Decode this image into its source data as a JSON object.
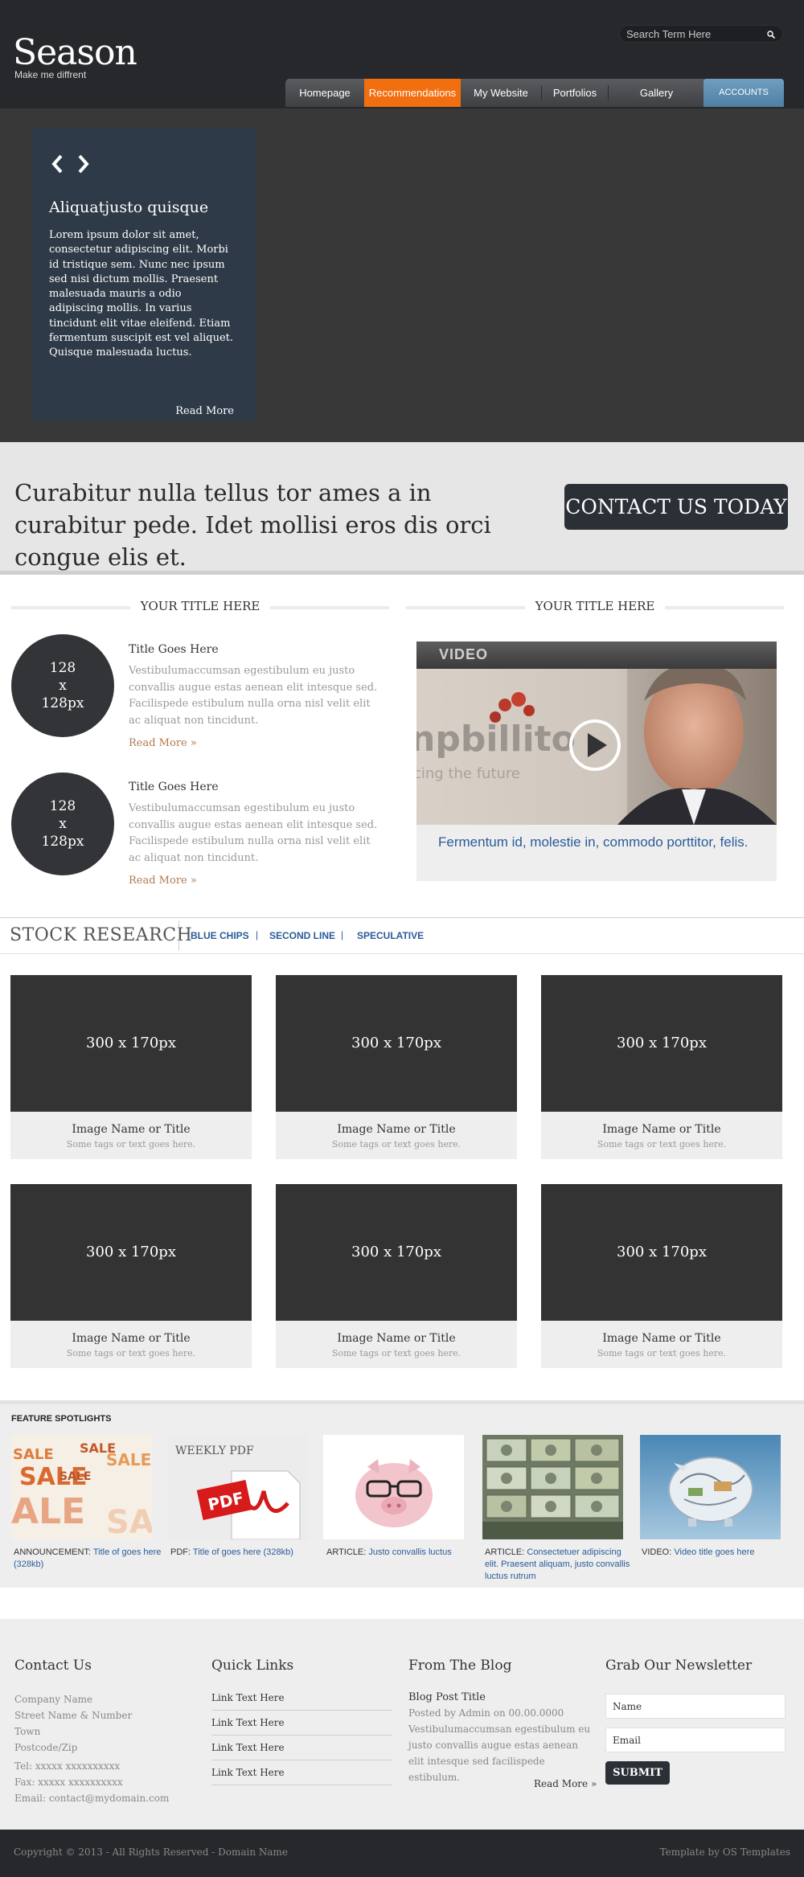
{
  "header": {
    "logo": "Season",
    "tagline": "Make me diffrent",
    "search_placeholder": "Search Term Here",
    "nav": [
      "Homepage",
      "Recommendations",
      "My Website",
      "Portfolios",
      "Gallery",
      "ACCOUNTS"
    ],
    "active_nav": "Recommendations",
    "accent_color": "#f26f10"
  },
  "slider": {
    "title": "Aliquatjusto quisque",
    "text": "Lorem ipsum dolor sit amet, consectetur adipiscing elit. Morbi id tristique sem. Nunc nec ipsum sed nisi dictum mollis. Praesent malesuada mauris a odio adipiscing mollis. In varius tincidunt elit vitae eleifend. Etiam fermentum suscipit est vel aliquet. Quisque malesuada luctus.",
    "read_more": "Read More"
  },
  "cta": {
    "text": "Curabitur nulla tellus tor ames a in curabitur pede. Idet mollisi eros dis orci congue elis et.",
    "button": "CONTACT US TODAY"
  },
  "left_section": {
    "title": "YOUR TITLE HERE",
    "posts": [
      {
        "thumb": "128\nx\n128px",
        "title": "Title Goes Here",
        "text": "Vestibulumaccumsan egestibulum eu justo convallis augue estas aenean elit intesque sed. Facilispede estibulum nulla orna nisl velit elit ac aliquat non tincidunt.",
        "more": "Read More »"
      },
      {
        "thumb": "128\nx\n128px",
        "title": "Title Goes Here",
        "text": "Vestibulumaccumsan egestibulum eu justo convallis augue estas aenean elit intesque sed. Facilispede estibulum nulla orna nisl velit elit ac aliquat non tincidunt.",
        "more": "Read More »"
      }
    ]
  },
  "right_section": {
    "title": "YOUR TITLE HERE",
    "video_label": "VIDEO",
    "video_image_text": "npbillito",
    "video_image_subtext": "cing the future",
    "caption": "Fermentum id, molestie in, commodo porttitor, felis."
  },
  "stock": {
    "title": "STOCK RESEARCH",
    "tabs": [
      "BLUE CHIPS",
      "SECOND LINE",
      "SPECULATIVE"
    ],
    "cards": [
      {
        "img": "300 x 170px",
        "name": "Image Name or Title",
        "tags": "Some tags or text goes here."
      },
      {
        "img": "300 x 170px",
        "name": "Image Name or Title",
        "tags": "Some tags or text goes here."
      },
      {
        "img": "300 x 170px",
        "name": "Image Name or Title",
        "tags": "Some tags or text goes here."
      },
      {
        "img": "300 x 170px",
        "name": "Image Name or Title",
        "tags": "Some tags or text goes here."
      },
      {
        "img": "300 x 170px",
        "name": "Image Name or Title",
        "tags": "Some tags or text goes here."
      },
      {
        "img": "300 x 170px",
        "name": "Image Name or Title",
        "tags": "Some tags or text goes here."
      }
    ]
  },
  "features": {
    "title": "FEATURE SPOTLIGHTS",
    "items": [
      {
        "image": "sale-image",
        "prefix": "ANNOUNCEMENT:",
        "link": "Title of goes here (328kb)"
      },
      {
        "image": "pdf-image",
        "image_text": "WEEKLY PDF",
        "badge": "PDF",
        "prefix": "PDF:",
        "link": "Title of goes here (328kb)"
      },
      {
        "image": "piggy-image",
        "prefix": "ARTICLE:",
        "link": "Justo convallis luctus"
      },
      {
        "image": "money-image",
        "prefix": "ARTICLE:",
        "link": "Consectetuer adipiscing elit. Praesent aliquam,  justo convallis luctus rutrum"
      },
      {
        "image": "glass-piggy-image",
        "prefix": "VIDEO:",
        "link": "Video title goes here"
      }
    ]
  },
  "footer": {
    "contact": {
      "title": "Contact Us",
      "lines": [
        "Company Name",
        "Street Name & Number",
        "Town",
        "Postcode/Zip"
      ],
      "tel": "Tel: xxxxx xxxxxxxxxx",
      "fax": "Fax: xxxxx xxxxxxxxxx",
      "email": "Email: contact@mydomain.com"
    },
    "links": {
      "title": "Quick Links",
      "items": [
        "Link Text Here",
        "Link Text Here",
        "Link Text Here",
        "Link Text Here"
      ]
    },
    "blog": {
      "title": "From The Blog",
      "post_title": "Blog Post Title",
      "meta": "Posted by Admin on 00.00.0000",
      "text": "Vestibulumaccumsan egestibulum eu justo convallis augue estas aenean elit intesque sed facilispede estibulum.",
      "more": "Read More »"
    },
    "newsletter": {
      "title": "Grab Our Newsletter",
      "name_placeholder": "Name",
      "email_placeholder": "Email",
      "submit": "SUBMIT"
    }
  },
  "bottom": {
    "copyright": "Copyright © 2013 - All Rights Reserved - Domain Name",
    "credit": "Template by OS Templates"
  }
}
